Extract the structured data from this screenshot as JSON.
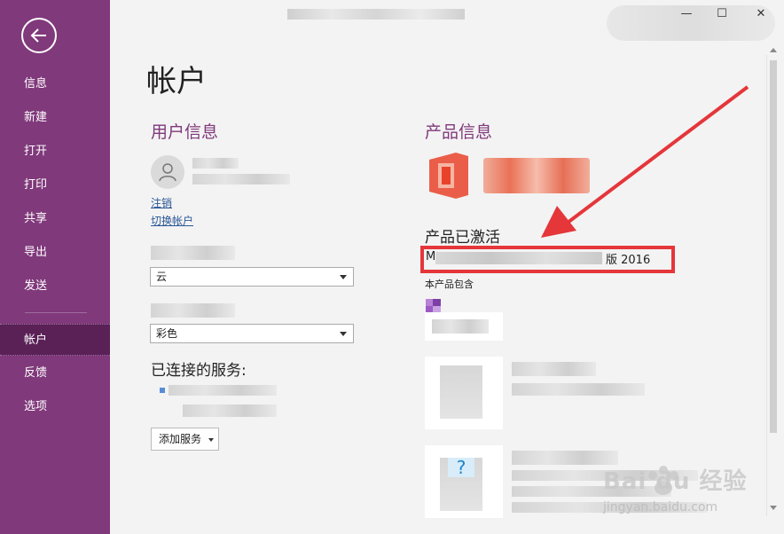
{
  "sidebar": {
    "items": [
      {
        "label": "信息"
      },
      {
        "label": "新建"
      },
      {
        "label": "打开"
      },
      {
        "label": "打印"
      },
      {
        "label": "共享"
      },
      {
        "label": "导出"
      },
      {
        "label": "发送"
      },
      {
        "label": "帐户"
      },
      {
        "label": "反馈"
      },
      {
        "label": "选项"
      }
    ],
    "active_index": 7
  },
  "window": {
    "minimize": "—",
    "maximize": "☐",
    "close": "✕"
  },
  "page": {
    "title": "帐户"
  },
  "user_info": {
    "title": "用户信息",
    "sign_out": "注销",
    "switch_account": "切换帐户",
    "background_value": "云",
    "theme_value": "彩色",
    "connected_title": "已连接的服务:",
    "add_service": "添加服务"
  },
  "product_info": {
    "title": "产品信息",
    "activated": "产品已激活",
    "version_prefix": "M",
    "version_suffix": "版 2016",
    "includes": "本产品包含"
  },
  "watermark": {
    "brand": "Bai du 经验",
    "url": "jingyan.baidu.com"
  },
  "colors": {
    "accent": "#80397b",
    "accent_dark": "#5a2157",
    "office_orange": "#e8432a",
    "highlight_red": "#e5363a"
  }
}
